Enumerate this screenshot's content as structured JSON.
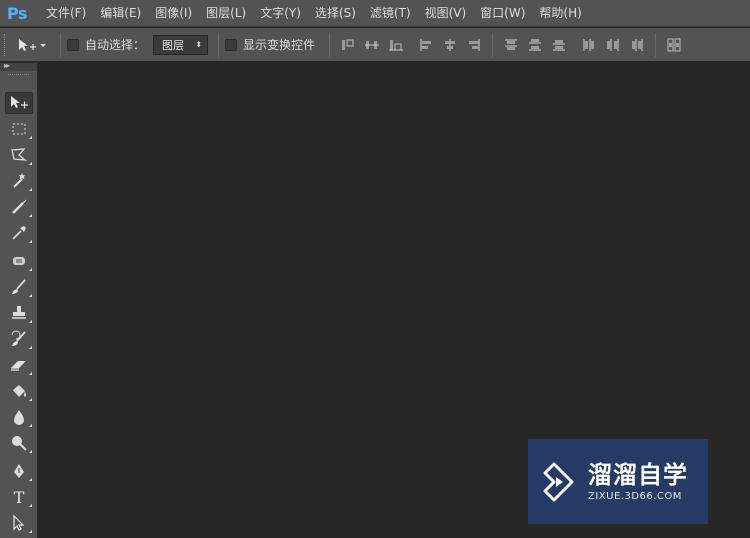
{
  "app": {
    "logo_text": "Ps"
  },
  "menu": {
    "items": [
      {
        "label": "文件(F)"
      },
      {
        "label": "编辑(E)"
      },
      {
        "label": "图像(I)"
      },
      {
        "label": "图层(L)"
      },
      {
        "label": "文字(Y)"
      },
      {
        "label": "选择(S)"
      },
      {
        "label": "滤镜(T)"
      },
      {
        "label": "视图(V)"
      },
      {
        "label": "窗口(W)"
      },
      {
        "label": "帮助(H)"
      }
    ]
  },
  "options_bar": {
    "tool_preset_icon": "move-tool-icon",
    "auto_select": {
      "label": "自动选择：",
      "checked": false
    },
    "auto_select_target": {
      "value": "图层"
    },
    "show_transform": {
      "label": "显示变换控件",
      "checked": false
    },
    "align_icons": [
      "align-top-edges-icon",
      "align-vertical-centers-icon",
      "align-bottom-edges-icon",
      "align-left-edges-icon",
      "align-horizontal-centers-icon",
      "align-right-edges-icon",
      "distribute-top-edges-icon",
      "distribute-vertical-centers-icon",
      "distribute-bottom-edges-icon",
      "distribute-left-edges-icon",
      "distribute-horizontal-centers-icon",
      "distribute-right-edges-icon",
      "auto-align-layers-icon"
    ]
  },
  "toolbar": {
    "tools": [
      {
        "name": "move-tool",
        "icon": "move-icon",
        "active": true
      },
      {
        "name": "rectangular-marquee-tool",
        "icon": "marquee-icon"
      },
      {
        "name": "lasso-tool",
        "icon": "lasso-icon"
      },
      {
        "name": "magic-wand-tool",
        "icon": "magic-wand-icon"
      },
      {
        "name": "crop-tool",
        "icon": "crop-icon"
      },
      {
        "name": "eyedropper-tool",
        "icon": "eyedropper-icon"
      },
      {
        "name": "spot-healing-tool",
        "icon": "healing-brush-icon"
      },
      {
        "name": "brush-tool",
        "icon": "brush-icon"
      },
      {
        "name": "clone-stamp-tool",
        "icon": "clone-stamp-icon"
      },
      {
        "name": "history-brush-tool",
        "icon": "history-brush-icon"
      },
      {
        "name": "eraser-tool",
        "icon": "eraser-icon"
      },
      {
        "name": "paint-bucket-tool",
        "icon": "paint-bucket-icon"
      },
      {
        "name": "blur-tool",
        "icon": "blur-drop-icon"
      },
      {
        "name": "dodge-tool",
        "icon": "dodge-icon"
      },
      {
        "name": "pen-tool",
        "icon": "pen-icon"
      },
      {
        "name": "type-tool",
        "icon": "type-icon",
        "glyph": "T"
      },
      {
        "name": "path-selection-tool",
        "icon": "path-selection-icon"
      }
    ]
  },
  "watermark": {
    "title": "溜溜自学",
    "url": "ZIXUE.3D66.COM",
    "logo_icon": "play-logo-icon",
    "bg_color": "#253a64"
  },
  "colors": {
    "menubar": "#535353",
    "workspace": "#262626",
    "logo": "#4fb3ff"
  }
}
